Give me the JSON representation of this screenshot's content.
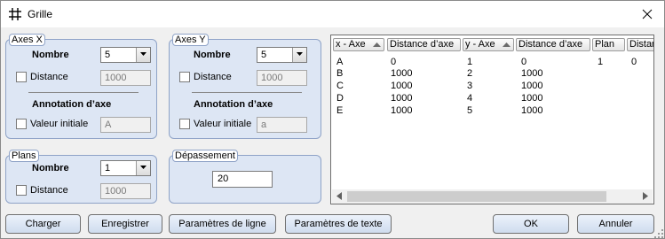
{
  "window": {
    "title": "Grille"
  },
  "axes_x": {
    "legend": "Axes X",
    "nombre_label": "Nombre",
    "nombre_value": "5",
    "distance_label": "Distance",
    "distance_value": "1000",
    "annotation_label": "Annotation d’axe",
    "valeur_label": "Valeur initiale",
    "valeur_value": "A"
  },
  "axes_y": {
    "legend": "Axes Y",
    "nombre_label": "Nombre",
    "nombre_value": "5",
    "distance_label": "Distance",
    "distance_value": "1000",
    "annotation_label": "Annotation d’axe",
    "valeur_label": "Valeur initiale",
    "valeur_value": "a"
  },
  "plans": {
    "legend": "Plans",
    "nombre_label": "Nombre",
    "nombre_value": "1",
    "distance_label": "Distance",
    "distance_value": "1000"
  },
  "depassement": {
    "legend": "Dépassement",
    "value": "20"
  },
  "table": {
    "headers": [
      "x - Axe",
      "Distance d’axe",
      "y - Axe",
      "Distance d’axe",
      "Plan",
      "Distan"
    ],
    "rows": [
      [
        "A",
        "0",
        "1",
        "0",
        "1",
        "0"
      ],
      [
        "B",
        "1000",
        "2",
        "1000",
        "",
        ""
      ],
      [
        "C",
        "1000",
        "3",
        "1000",
        "",
        ""
      ],
      [
        "D",
        "1000",
        "4",
        "1000",
        "",
        ""
      ],
      [
        "E",
        "1000",
        "5",
        "1000",
        "",
        ""
      ]
    ]
  },
  "buttons": {
    "charger": "Charger",
    "enregistrer": "Enregistrer",
    "param_ligne": "Paramètres de ligne",
    "param_texte": "Paramètres de texte",
    "ok": "OK",
    "annuler": "Annuler"
  },
  "colors": {
    "group_bg": "#dde6f4",
    "group_border": "#8fa3c7",
    "button_bg": "#cfdcee"
  }
}
